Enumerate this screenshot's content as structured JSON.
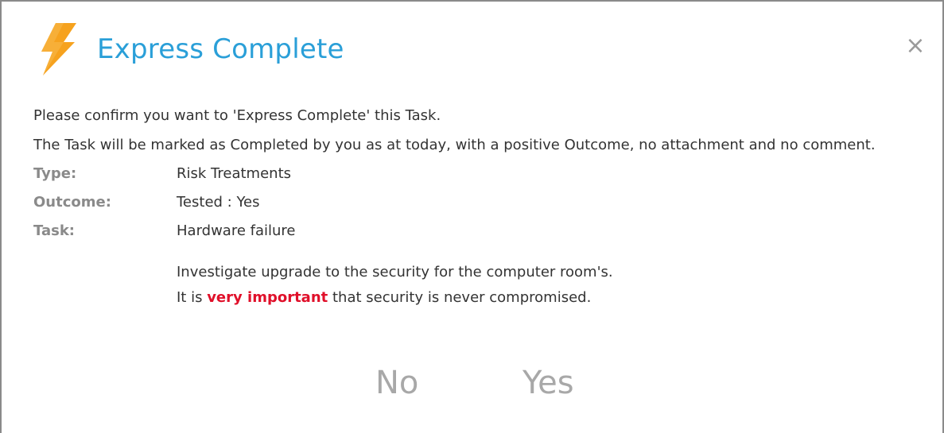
{
  "dialog": {
    "title": "Express Complete",
    "close_glyph": "×",
    "icon": "lightning-bolt-icon",
    "accent_color": "#2a9fd8",
    "icon_color": "#f6a21e"
  },
  "message": {
    "line1": "Please confirm you want to 'Express Complete' this Task.",
    "line2": "The Task will be marked as Completed by you as at today, with a positive Outcome, no attachment and no comment."
  },
  "details": {
    "type_label": "Type:",
    "type_value": "Risk Treatments",
    "outcome_label": "Outcome:",
    "outcome_value": "Tested : Yes",
    "task_label": "Task:",
    "task_value": "Hardware failure"
  },
  "description": {
    "line1": "Investigate upgrade to the security for the computer room's.",
    "line2_before": "It is ",
    "line2_emphasis": "very important",
    "line2_after": " that security is never compromised.",
    "emphasis_color": "#e0102a"
  },
  "actions": {
    "no_label": "No",
    "yes_label": "Yes"
  }
}
